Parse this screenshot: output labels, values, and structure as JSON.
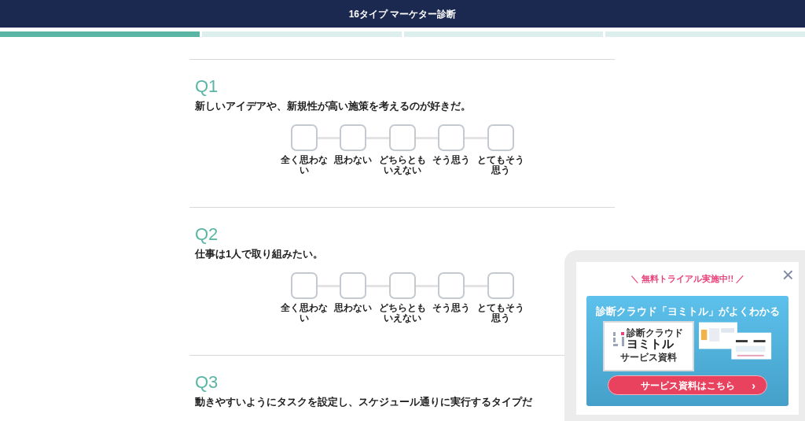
{
  "header": {
    "title": "16タイプ マーケター診断"
  },
  "progress": [
    {
      "filled": true
    },
    {
      "filled": false
    },
    {
      "filled": false
    },
    {
      "filled": false
    }
  ],
  "questions": [
    {
      "number": "Q1",
      "text": "新しいアイデアや、新規性が高い施策を考えるのが好きだ。",
      "choices": [
        {
          "label": "全く思わない",
          "selected": false
        },
        {
          "label": "思わない",
          "selected": false
        },
        {
          "label": "どちらともいえない",
          "selected": false
        },
        {
          "label": "そう思う",
          "selected": false
        },
        {
          "label": "とてもそう思う",
          "selected": false
        }
      ]
    },
    {
      "number": "Q2",
      "text": "仕事は1人で取り組みたい。",
      "choices": [
        {
          "label": "全く思わない",
          "selected": false
        },
        {
          "label": "思わない",
          "selected": false
        },
        {
          "label": "どちらともいえない",
          "selected": false
        },
        {
          "label": "そう思う",
          "selected": false
        },
        {
          "label": "とてもそう思う",
          "selected": false
        }
      ]
    },
    {
      "number": "Q3",
      "text": "動きやすいようにタスクを設定し、スケジュール通りに実行するタイプだ"
    }
  ],
  "popup": {
    "close": "×",
    "headline": "＼ 無料トライアル実施中!! ／",
    "banner_title": "診断クラウド「ヨミトル」がよくわかる",
    "logo_caption": "診断クラウド",
    "logo_name": "ヨミトル",
    "document_label": "サービス資料",
    "cta": "サービス資料はこちら",
    "cta_arrow": "›"
  }
}
